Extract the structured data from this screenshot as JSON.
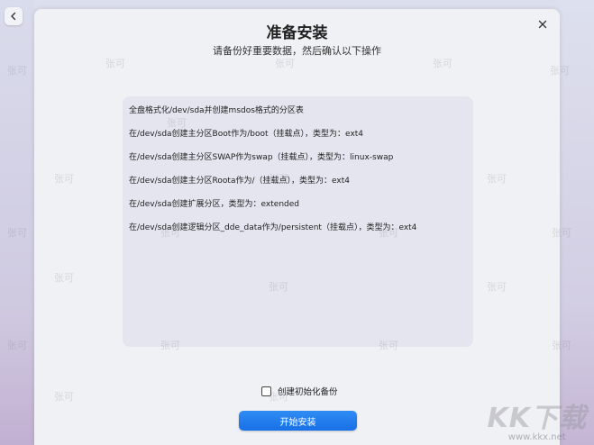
{
  "dialog": {
    "title": "准备安装",
    "subtitle": "请备份好重要数据，然后确认以下操作"
  },
  "operations": [
    "全盘格式化/dev/sda并创建msdos格式的分区表",
    "在/dev/sda创建主分区Boot作为/boot（挂载点），类型为：ext4",
    "在/dev/sda创建主分区SWAP作为swap（挂载点），类型为：linux-swap",
    "在/dev/sda创建主分区Roota作为/（挂载点），类型为：ext4",
    "在/dev/sda创建扩展分区，类型为：extended",
    "在/dev/sda创建逻辑分区_dde_data作为/persistent（挂载点），类型为：ext4"
  ],
  "backup_checkbox": {
    "label": "创建初始化备份",
    "checked": false
  },
  "install_button": {
    "label": "开始安装"
  },
  "icons": {
    "back": "chevron-left-icon",
    "close": "close-icon"
  },
  "watermark": {
    "text": "张可",
    "logo": "KK下载",
    "url": "www.kkx.net"
  },
  "colors": {
    "accent": "#1f7df0",
    "dialog_bg": "#f0f1f5",
    "panel_bg": "#e4e5ef"
  }
}
